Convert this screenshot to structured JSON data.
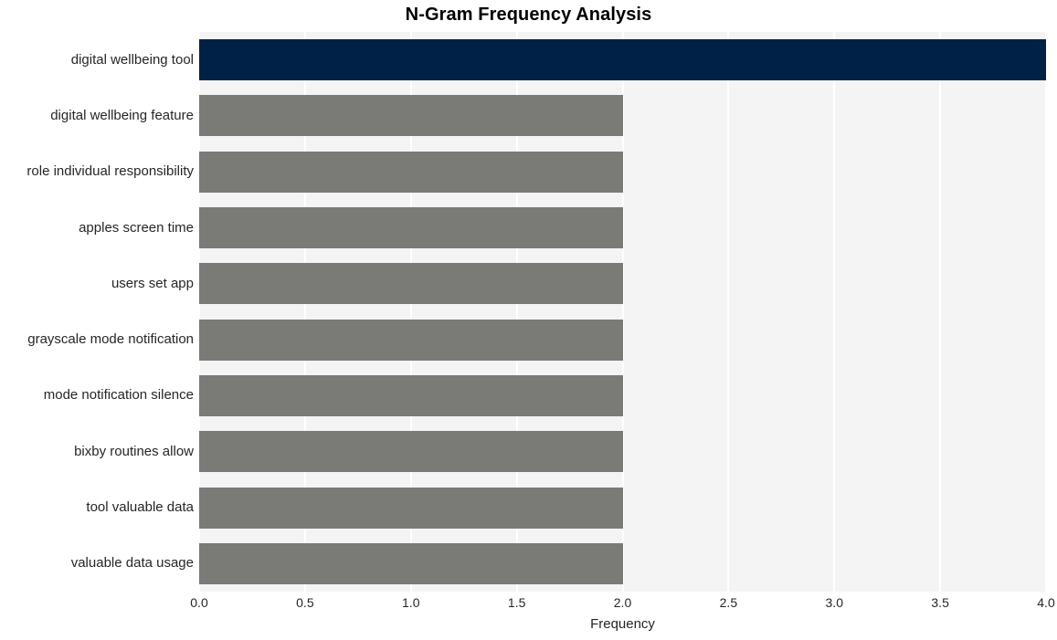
{
  "chart_data": {
    "type": "bar",
    "orientation": "horizontal",
    "title": "N-Gram Frequency Analysis",
    "xlabel": "Frequency",
    "ylabel": "",
    "categories": [
      "digital wellbeing tool",
      "digital wellbeing feature",
      "role individual responsibility",
      "apples screen time",
      "users set app",
      "grayscale mode notification",
      "mode notification silence",
      "bixby routines allow",
      "tool valuable data",
      "valuable data usage"
    ],
    "values": [
      4,
      2,
      2,
      2,
      2,
      2,
      2,
      2,
      2,
      2
    ],
    "bar_colors": [
      "#002147",
      "#7a7a77",
      "#7a7a77",
      "#7a7a77",
      "#7a7a77",
      "#7a7a77",
      "#7a7a77",
      "#7a7a77",
      "#7a7a77",
      "#7a7a77"
    ],
    "xlim": [
      0,
      4
    ],
    "xticks": [
      0,
      0.5,
      1,
      1.5,
      2,
      2.5,
      3,
      3.5,
      4
    ],
    "xtick_labels": [
      "0.0",
      "0.5",
      "1.0",
      "1.5",
      "2.0",
      "2.5",
      "3.0",
      "3.5",
      "4.0"
    ],
    "grid": true,
    "grid_axis": "x",
    "grid_color": "#ffffff",
    "legend": false,
    "plot_background": "#f4f4f5",
    "figure_background": "#ffffff",
    "highlight_color": "#002147",
    "base_color": "#7a7a77"
  }
}
